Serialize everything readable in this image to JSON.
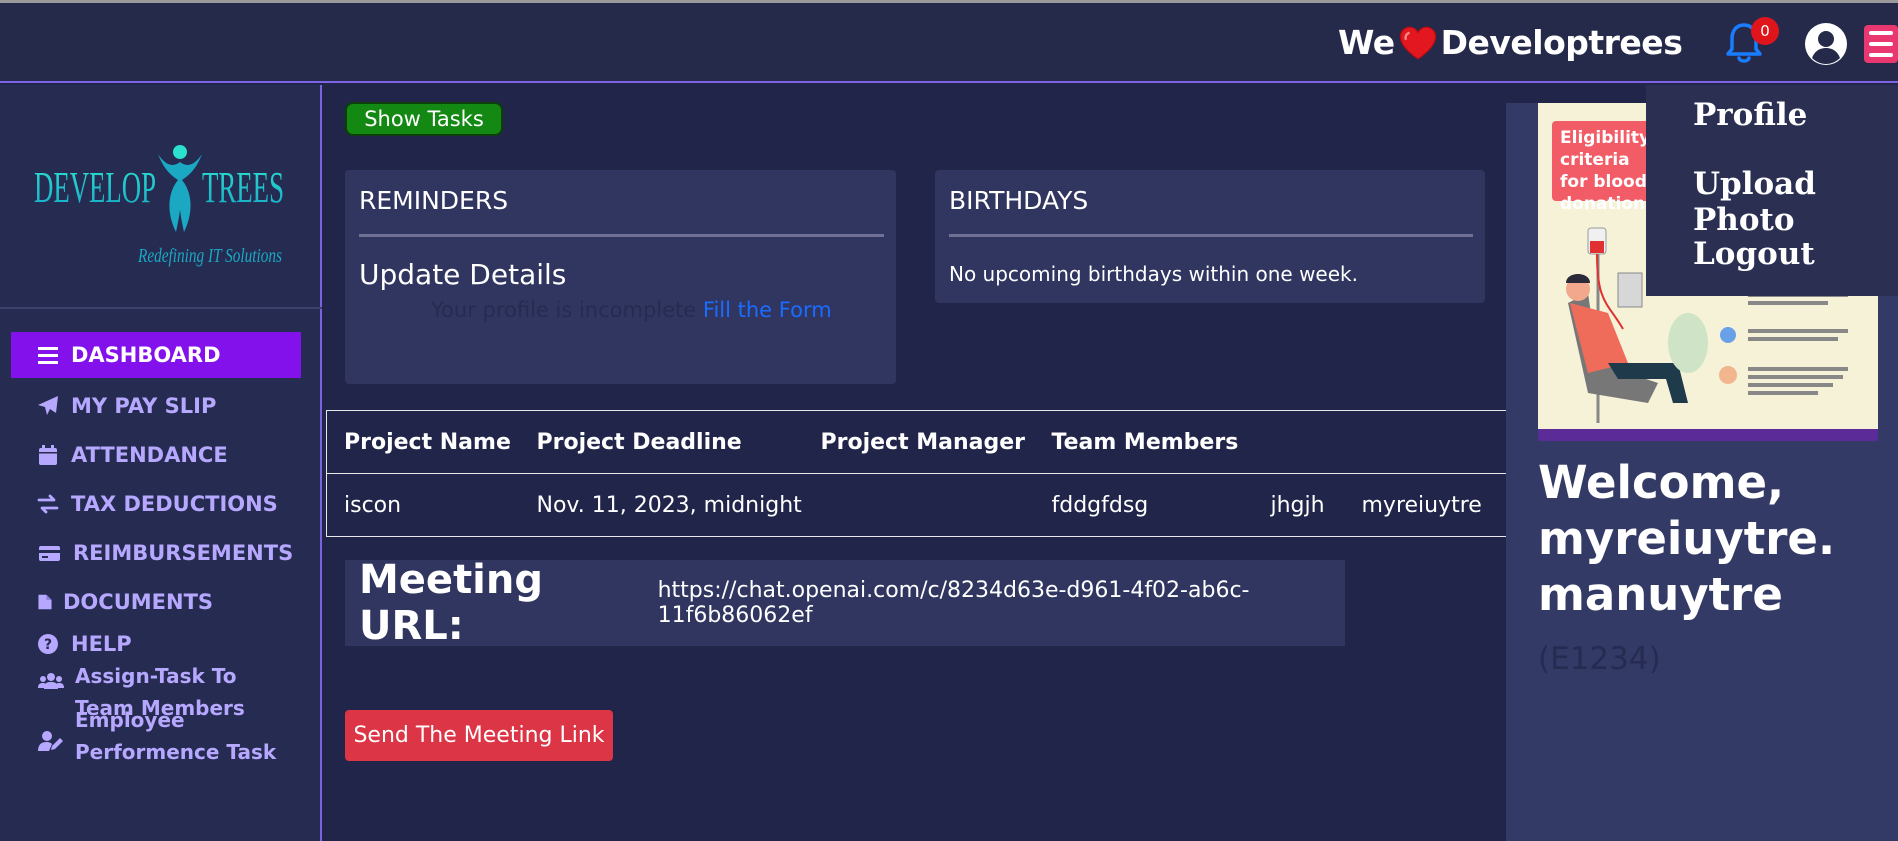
{
  "header": {
    "brand_pre": "We",
    "brand_post": "Developtrees",
    "notification_count": "0"
  },
  "sidebar": {
    "logo_text": "DEVELOPTREES",
    "logo_tagline": "Redefining IT Solutions",
    "items": [
      {
        "label": "DASHBOARD",
        "icon": "bars-icon"
      },
      {
        "label": "MY PAY SLIP",
        "icon": "paper-plane-icon"
      },
      {
        "label": "ATTENDANCE",
        "icon": "calendar-icon"
      },
      {
        "label": "TAX DEDUCTIONS",
        "icon": "exchange-icon"
      },
      {
        "label": "REIMBURSEMENTS",
        "icon": "credit-card-icon"
      },
      {
        "label": "DOCUMENTS",
        "icon": "file-icon"
      },
      {
        "label": "HELP",
        "icon": "question-circle-icon"
      },
      {
        "label_1": "Assign-Task To",
        "label_2": "Team Members",
        "icon": "users-icon"
      },
      {
        "label_1": "Employee",
        "label_2": "Performence Task",
        "icon": "user-edit-icon"
      }
    ]
  },
  "main": {
    "show_tasks": "Show Tasks",
    "reminders": {
      "title": "REMINDERS",
      "heading": "Update Details",
      "message": "Your profile is incomplete",
      "link": "Fill the Form"
    },
    "birthdays": {
      "title": "BIRTHDAYS",
      "message": "No upcoming birthdays within one week."
    },
    "table": {
      "headers": [
        "Project Name",
        "Project Deadline",
        "Project Manager",
        "Team Members"
      ],
      "rows": [
        {
          "name": "iscon",
          "deadline": "Nov. 11, 2023, midnight",
          "manager": "",
          "members": [
            "fddgfdsg",
            "jhgjh",
            "myreiuytre"
          ]
        }
      ]
    },
    "meeting": {
      "label": "Meeting URL:",
      "url": "https://chat.openai.com/c/8234d63e-d961-4f02-ab6c-11f6b86062ef"
    },
    "send_button": "Send The Meeting Link"
  },
  "right_panel": {
    "poster_title": "Eligibility criteria for blood donation",
    "welcome": "Welcome, myreiuytre. manuytre",
    "employee_id": "(E1234)"
  },
  "dropdown": {
    "items": [
      "Profile",
      "Upload Photo",
      "Logout"
    ]
  },
  "colors": {
    "background": "#21254a",
    "active_nav": "#8311ec",
    "nav_text": "#b7a8ff",
    "send_button": "#dc3545",
    "show_tasks": "#138812",
    "menu_button": "#e9386f"
  }
}
